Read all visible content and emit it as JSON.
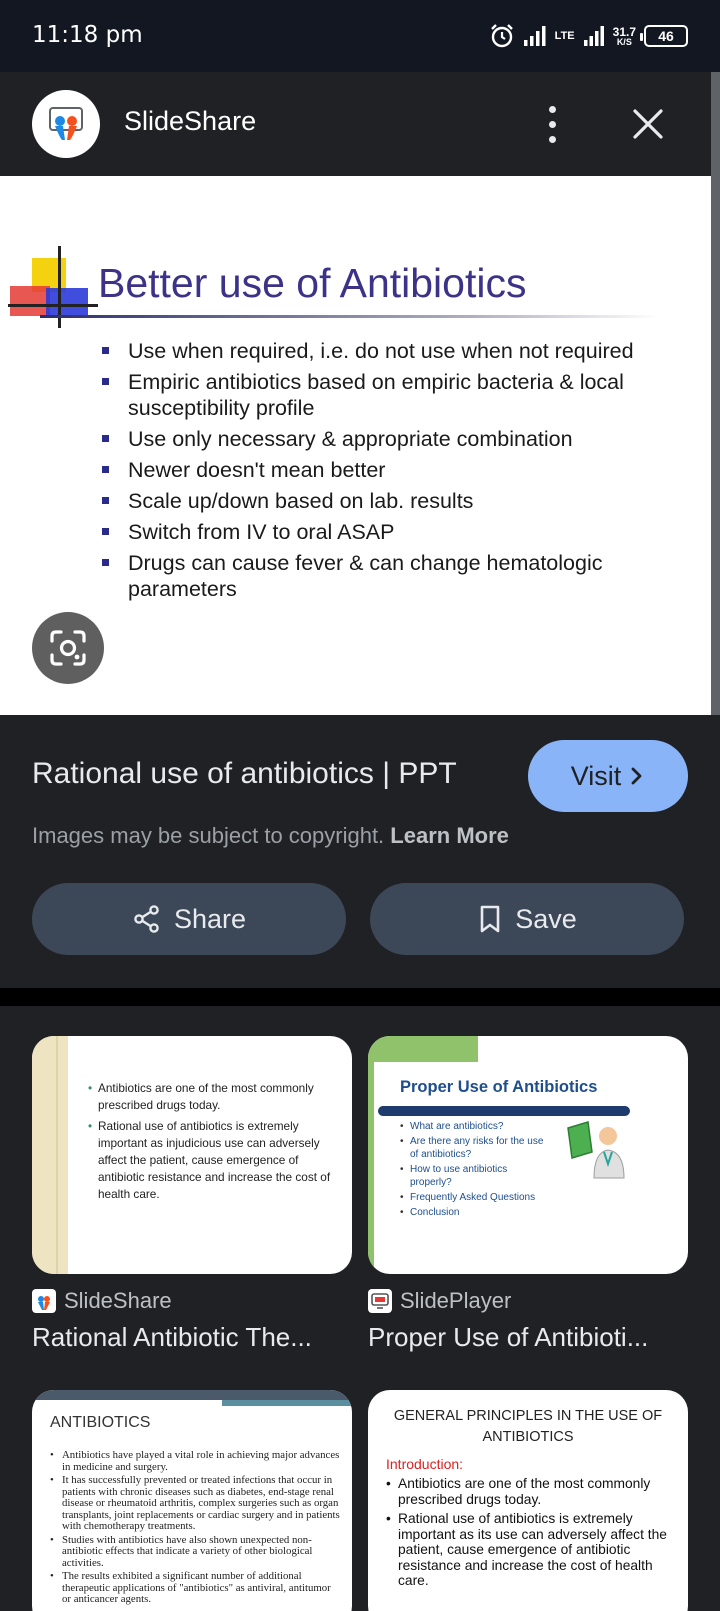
{
  "status_bar": {
    "time": "11:18 pm",
    "network": "LTE",
    "speed_value": "31.7",
    "speed_unit": "K/S",
    "battery": "46",
    "icons": [
      "alarm-icon",
      "signal-icon",
      "lte-signal-icon",
      "battery-icon"
    ]
  },
  "viewer": {
    "source_name": "SlideShare",
    "more_icon": "more-vert-icon",
    "close_icon": "close-icon",
    "lens_icon": "lens-icon"
  },
  "slide": {
    "title": "Better use of Antibiotics",
    "bullets": [
      "Use when required, i.e. do not use when not required",
      "Empiric antibiotics based on empiric bacteria & local susceptibility profile",
      "Use only necessary & appropriate combination",
      "Newer doesn't mean better",
      "Scale up/down based on lab. results",
      "Switch from IV to oral ASAP",
      "Drugs can cause fever & can change hematologic parameters"
    ]
  },
  "result": {
    "title": "Rational use of antibiotics | PPT",
    "visit_label": "Visit",
    "copyright_text": "Images may be subject to copyright.",
    "learn_more": "Learn More",
    "share_label": "Share",
    "save_label": "Save"
  },
  "related": [
    {
      "source": "SlideShare",
      "title": "Rational Antibiotic The...",
      "thumb_bullets": [
        "Antibiotics are one of the most commonly prescribed drugs today.",
        "Rational use of antibiotics is extremely important as injudicious use can adversely affect the patient, cause emergence of antibiotic resistance and increase the cost of health care."
      ]
    },
    {
      "source": "SlidePlayer",
      "title": "Proper Use of Antibioti...",
      "thumb_title": "Proper Use of Antibiotics",
      "thumb_bullets": [
        "What are antibiotics?",
        "Are there any risks for the use of antibiotics?",
        "How to use antibiotics properly?",
        "Frequently Asked Questions",
        "Conclusion"
      ]
    },
    {
      "thumb_title": "ANTIBIOTICS",
      "thumb_bullets": [
        "Antibiotics have played a vital role in achieving major advances in medicine and surgery.",
        "It has successfully prevented or treated infections that occur in patients with chronic diseases such as diabetes, end-stage renal disease or rheumatoid arthritis, complex surgeries such as organ transplants, joint replacements or cardiac surgery and in patients with chemotherapy treatments.",
        "Studies with antibiotics have also shown unexpected non-antibiotic effects that indicate a variety of other biological activities.",
        "The results exhibited a significant number of additional therapeutic applications of \"antibiotics\" as antiviral, antitumor or anticancer agents."
      ]
    },
    {
      "thumb_title": "GENERAL PRINCIPLES IN THE USE OF ANTIBIOTICS",
      "thumb_intro": "Introduction:",
      "thumb_bullets": [
        "Antibiotics are one of the most commonly prescribed drugs today.",
        "Rational use of antibiotics is extremely important as its use can adversely affect the patient, cause emergence of antibiotic resistance and increase the cost of health care."
      ]
    }
  ]
}
